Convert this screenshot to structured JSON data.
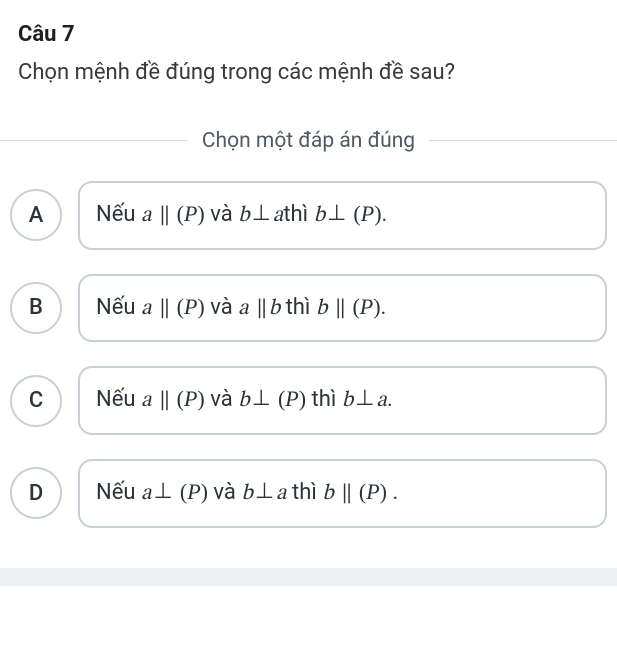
{
  "question": {
    "number": "Câu 7",
    "text": "Chọn mệnh đề đúng trong các mệnh đề sau?"
  },
  "instruction": "Chọn một đáp án đúng",
  "options": [
    {
      "letter": "A",
      "prefix": "Nếu ",
      "expr1_left": "a",
      "rel1": "∥",
      "expr1_right": "(P)",
      "connector": " và ",
      "expr2_left": "b",
      "rel2": "⊥",
      "expr2_right": "a",
      "then_word": "thì ",
      "expr3_left": "b",
      "rel3": "⊥",
      "expr3_right": "(P)",
      "tail": "."
    },
    {
      "letter": "B",
      "prefix": "Nếu ",
      "expr1_left": "a",
      "rel1": "∥",
      "expr1_right": "(P)",
      "connector": " và ",
      "expr2_left": "a",
      "rel2": "∥",
      "expr2_right": "b",
      "then_word": " thì ",
      "expr3_left": "b",
      "rel3": "∥",
      "expr3_right": "(P)",
      "tail": "."
    },
    {
      "letter": "C",
      "prefix": "Nếu ",
      "expr1_left": "a",
      "rel1": "∥",
      "expr1_right": "(P)",
      "connector": " và ",
      "expr2_left": "b",
      "rel2": "⊥",
      "expr2_right": "(P)",
      "then_word": " thì ",
      "expr3_left": "b",
      "rel3": "⊥",
      "expr3_right": "a",
      "tail": "."
    },
    {
      "letter": "D",
      "prefix": "Nếu ",
      "expr1_left": "a",
      "rel1": "⊥",
      "expr1_right": "(P)",
      "connector": " và ",
      "expr2_left": "b",
      "rel2": "⊥",
      "expr2_right": "a",
      "then_word": " thì ",
      "expr3_left": "b",
      "rel3": "∥",
      "expr3_right": "(P)",
      "tail": " ."
    }
  ]
}
